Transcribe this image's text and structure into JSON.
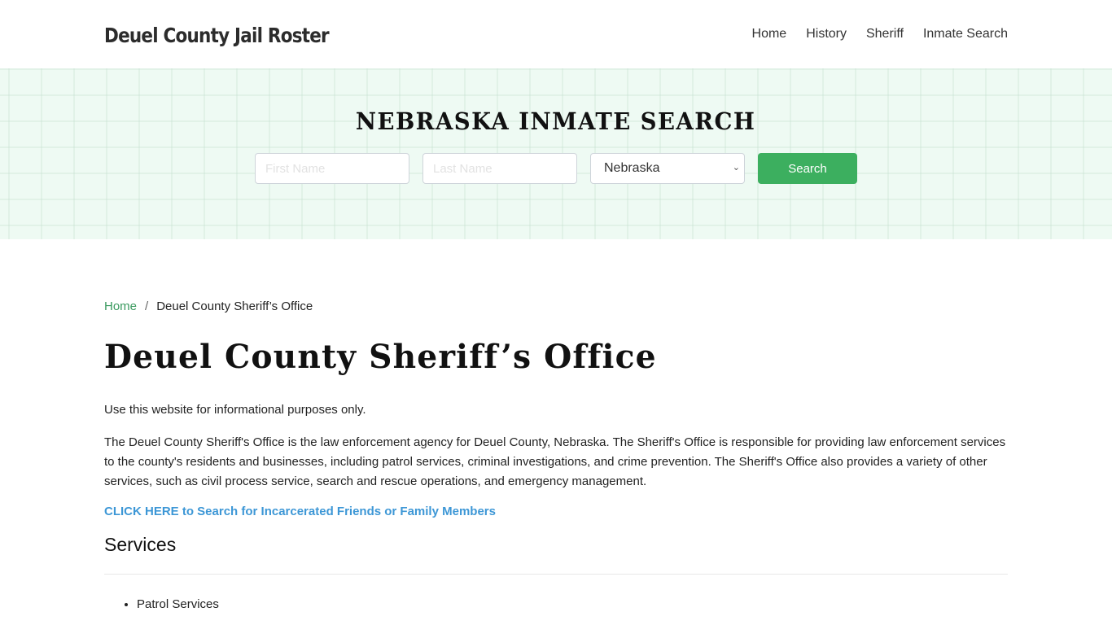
{
  "header": {
    "brand": "Deuel County Jail Roster",
    "nav": [
      {
        "label": "Home"
      },
      {
        "label": "History"
      },
      {
        "label": "Sheriff"
      },
      {
        "label": "Inmate Search"
      }
    ]
  },
  "hero": {
    "title": "NEBRASKA INMATE SEARCH",
    "first_name_placeholder": "First Name",
    "first_name_value": "",
    "last_name_placeholder": "Last Name",
    "last_name_value": "",
    "state_selected": "Nebraska",
    "search_button": "Search",
    "accent_color": "#3caf5f"
  },
  "breadcrumb": {
    "home": "Home",
    "separator": "/",
    "current": "Deuel County Sheriff’s Office"
  },
  "main": {
    "title": "Deuel County Sheriff’s Office",
    "paragraph1": "Use this website for informational purposes only.",
    "paragraph2": "The Deuel County Sheriff's Office is the law enforcement agency for Deuel County, Nebraska. The Sheriff's Office is responsible for providing law enforcement services to the county's residents and businesses, including patrol services, criminal investigations, and crime prevention. The Sheriff's Office also provides a variety of other services, such as civil process service, search and rescue operations, and emergency management.",
    "cta_link": "CLICK HERE to Search for Incarcerated Friends or Family Members",
    "services_heading": "Services",
    "services": [
      "Patrol Services"
    ]
  }
}
